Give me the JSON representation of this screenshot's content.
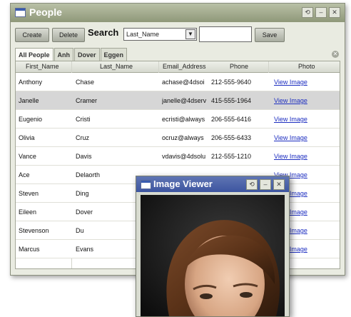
{
  "window": {
    "title": "People"
  },
  "toolbar": {
    "create_label": "Create",
    "delete_label": "Delete",
    "search_label": "Search",
    "search_field_selected": "Last_Name",
    "search_value": "",
    "save_label": "Save"
  },
  "tabs": [
    "All People",
    "Anh",
    "Dover",
    "Eggen"
  ],
  "columns": [
    "First_Name",
    "Last_Name",
    "Email_Address",
    "Phone",
    "Photo"
  ],
  "rows": [
    {
      "first": "Anthony",
      "last": "Chase",
      "email": "achase@4dsoi",
      "phone": "212-555-9640",
      "photo": "View Image"
    },
    {
      "first": "Janelle",
      "last": "Cramer",
      "email": "janelle@4dserv",
      "phone": "415-555-1964",
      "photo": "View Image"
    },
    {
      "first": "Eugenio",
      "last": "Cristi",
      "email": "ecristi@always",
      "phone": "206-555-6416",
      "photo": "View Image"
    },
    {
      "first": "Olivia",
      "last": "Cruz",
      "email": "ocruz@always",
      "phone": "206-555-6433",
      "photo": "View Image"
    },
    {
      "first": "Vance",
      "last": "Davis",
      "email": "vdavis@4dsolu",
      "phone": "212-555-1210",
      "photo": "View Image"
    },
    {
      "first": "Ace",
      "last": "Delaorth",
      "email": "",
      "phone": "",
      "photo": "View Image"
    },
    {
      "first": "Steven",
      "last": "Ding",
      "email": "",
      "phone": "",
      "photo": "View Image"
    },
    {
      "first": "Eileen",
      "last": "Dover",
      "email": "",
      "phone": "",
      "photo": "View Image"
    },
    {
      "first": "Stevenson",
      "last": "Du",
      "email": "",
      "phone": "",
      "photo": "View Image"
    },
    {
      "first": "Marcus",
      "last": "Evans",
      "email": "",
      "phone": "",
      "photo": "View Image"
    }
  ],
  "selected_row": 1,
  "image_viewer": {
    "title": "Image Viewer"
  },
  "colors": {
    "titlebar": "#9aa283",
    "viewer_titlebar": "#4a62aa",
    "link": "#1d2ec0",
    "selected_row": "#d6d6d6"
  }
}
